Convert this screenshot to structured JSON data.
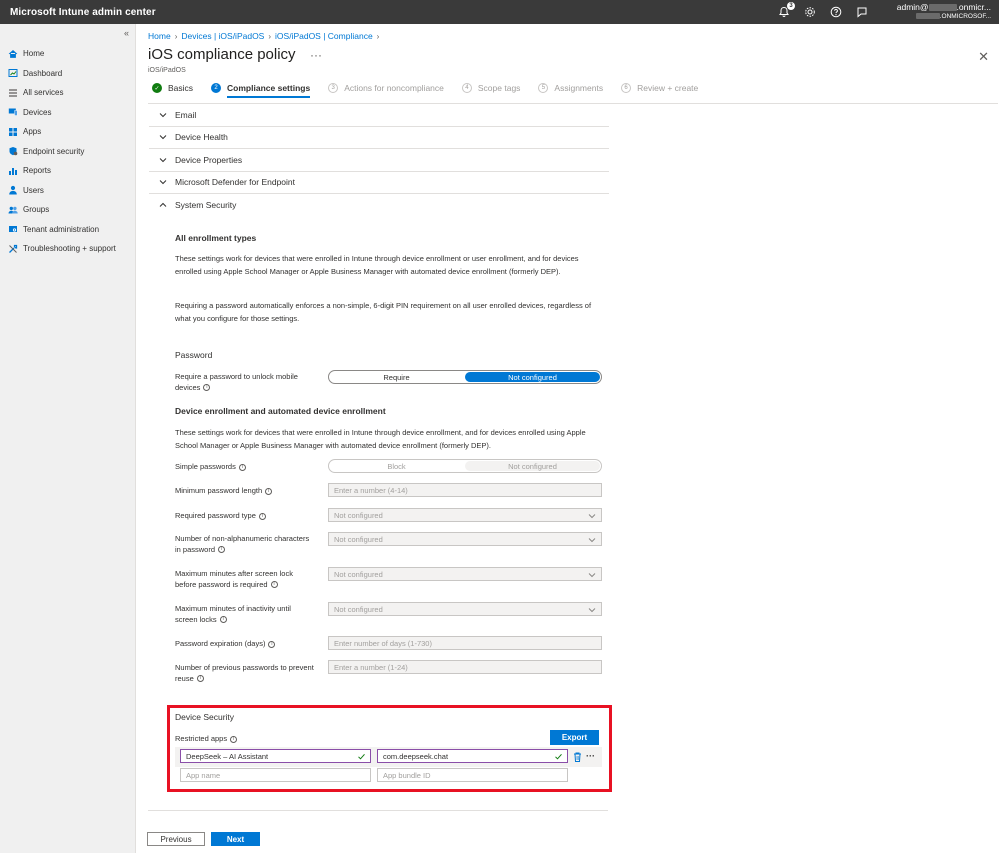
{
  "app": {
    "title": "Microsoft Intune admin center",
    "notification_count": "3",
    "account_line1_prefix": "admin@",
    "account_line1_suffix": ".onmicr...",
    "account_line2_suffix": ".ONMICROSOF..."
  },
  "sidebar": {
    "collapse": "«",
    "items": [
      {
        "label": "Home",
        "icon": "home-icon"
      },
      {
        "label": "Dashboard",
        "icon": "dashboard-icon"
      },
      {
        "label": "All services",
        "icon": "all-services-icon"
      },
      {
        "label": "Devices",
        "icon": "devices-icon"
      },
      {
        "label": "Apps",
        "icon": "apps-icon"
      },
      {
        "label": "Endpoint security",
        "icon": "endpoint-security-icon"
      },
      {
        "label": "Reports",
        "icon": "reports-icon"
      },
      {
        "label": "Users",
        "icon": "users-icon"
      },
      {
        "label": "Groups",
        "icon": "groups-icon"
      },
      {
        "label": "Tenant administration",
        "icon": "tenant-admin-icon"
      },
      {
        "label": "Troubleshooting + support",
        "icon": "troubleshooting-icon"
      }
    ]
  },
  "breadcrumb": [
    "Home",
    "Devices | iOS/iPadOS",
    "iOS/iPadOS | Compliance"
  ],
  "page": {
    "title": "iOS compliance policy",
    "more": "···",
    "subtitle": "iOS/iPadOS",
    "close": "✕"
  },
  "steps": [
    {
      "num": "✓",
      "label": "Basics",
      "state": "done"
    },
    {
      "num": "2",
      "label": "Compliance settings",
      "state": "active"
    },
    {
      "num": "3",
      "label": "Actions for noncompliance",
      "state": "pending"
    },
    {
      "num": "4",
      "label": "Scope tags",
      "state": "pending"
    },
    {
      "num": "5",
      "label": "Assignments",
      "state": "pending"
    },
    {
      "num": "6",
      "label": "Review + create",
      "state": "pending"
    }
  ],
  "sections": [
    "Email",
    "Device Health",
    "Device Properties",
    "Microsoft Defender for Endpoint",
    "System Security"
  ],
  "system_security": {
    "all_enrollment_heading": "All enrollment types",
    "all_enrollment_p1": "These settings work for devices that were enrolled in Intune through device enrollment or user enrollment, and for devices enrolled using Apple School Manager or Apple Business Manager with automated device enrollment (formerly DEP).",
    "all_enrollment_p2": "Requiring a password automatically enforces a non-simple, 6-digit PIN requirement on all user enrolled devices, regardless of what you configure for those settings.",
    "password_heading": "Password",
    "require_password_label": "Require a password to unlock mobile devices",
    "require_option": "Require",
    "not_configured_option": "Not configured",
    "device_enrollment_heading": "Device enrollment and automated device enrollment",
    "device_enrollment_p": "These settings work for devices that were enrolled in Intune through device enrollment, and for devices enrolled using Apple School Manager or Apple Business Manager with automated device enrollment (formerly DEP).",
    "simple_passwords_label": "Simple passwords",
    "block_option": "Block",
    "min_length_label": "Minimum password length",
    "min_length_placeholder": "Enter a number (4-14)",
    "required_type_label": "Required password type",
    "required_type_value": "Not configured",
    "non_alpha_label": "Number of non-alphanumeric characters in password",
    "non_alpha_value": "Not configured",
    "max_minutes_lock_label": "Maximum minutes after screen lock before password is required",
    "max_minutes_lock_value": "Not configured",
    "max_inactivity_label": "Maximum minutes of inactivity until screen locks",
    "max_inactivity_value": "Not configured",
    "expiration_label": "Password expiration (days)",
    "expiration_placeholder": "Enter number of days (1-730)",
    "prev_passwords_label": "Number of previous passwords to prevent reuse",
    "prev_passwords_placeholder": "Enter a number (1-24)"
  },
  "device_security": {
    "heading": "Device Security",
    "restricted_apps_label": "Restricted apps",
    "export_label": "Export",
    "app_name_value": "DeepSeek – AI Assistant",
    "bundle_id_value": "com.deepseek.chat",
    "app_name_placeholder": "App name",
    "bundle_id_placeholder": "App bundle ID",
    "more": "···"
  },
  "footer": {
    "previous_label": "Previous",
    "next_label": "Next"
  },
  "colors": {
    "accent": "#0078d4",
    "highlight": "#e81123",
    "success": "#107c10",
    "topbar": "#3a3a3a"
  }
}
